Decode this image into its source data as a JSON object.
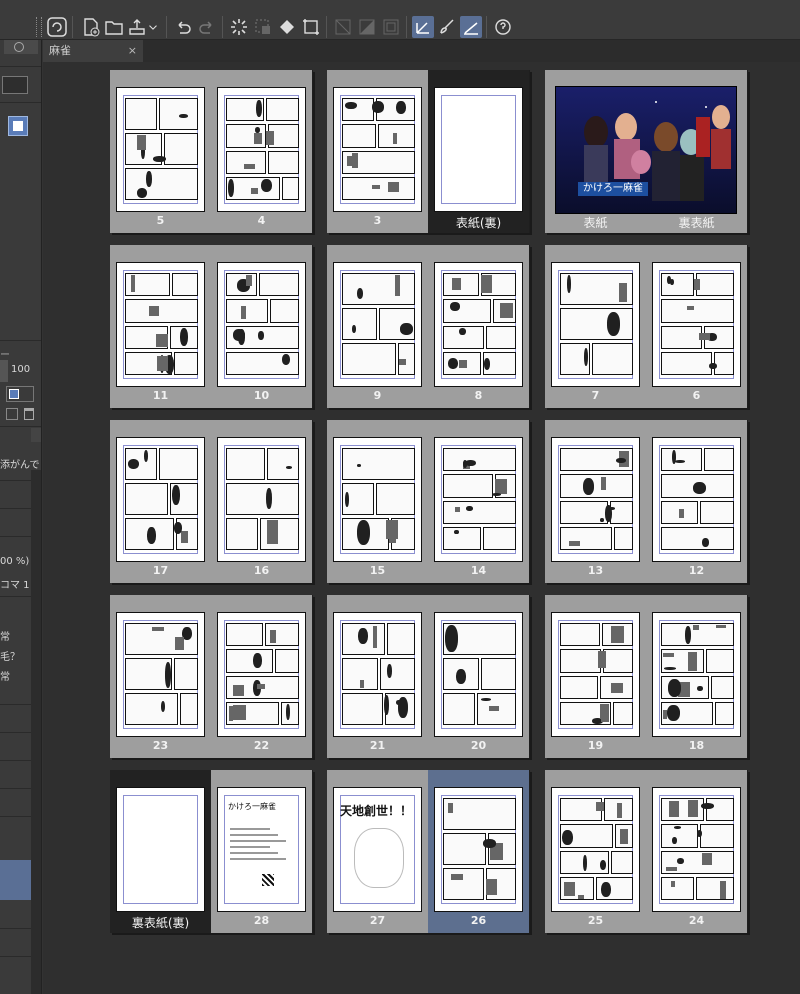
{
  "toolbar": {
    "items": [
      "clip-studio-logo",
      "new-file",
      "open-file",
      "export-dropdown",
      "undo",
      "redo",
      "transform-loading",
      "selection-layer",
      "fill",
      "transform",
      "fit-window",
      "rotate",
      "flip",
      "pen-tool",
      "brush-tool",
      "correction-line",
      "help-tips"
    ]
  },
  "left_panel": {
    "labels": {
      "opacity_value": "100",
      "text1": "添がんで",
      "text2": "00 %)",
      "text3": "コマ 1",
      "text4": "常",
      "text5": "毛？",
      "text6": "常"
    }
  },
  "document_tab": {
    "title": "麻雀",
    "close": "×"
  },
  "spreads": [
    {
      "left": {
        "label": "5"
      },
      "right": {
        "label": "4"
      }
    },
    {
      "left": {
        "label": "3"
      },
      "right": {
        "label": "表紙(裏)"
      }
    },
    {
      "cover": true,
      "left": {
        "label": "表紙"
      },
      "right": {
        "label": "裏表紙"
      },
      "cover_title": "かけろ一麻雀"
    },
    {
      "left": {
        "label": "11"
      },
      "right": {
        "label": "10"
      }
    },
    {
      "left": {
        "label": "9"
      },
      "right": {
        "label": "8"
      }
    },
    {
      "left": {
        "label": "7"
      },
      "right": {
        "label": "6"
      }
    },
    {
      "left": {
        "label": "17"
      },
      "right": {
        "label": "16"
      }
    },
    {
      "left": {
        "label": "15"
      },
      "right": {
        "label": "14"
      }
    },
    {
      "left": {
        "label": "13"
      },
      "right": {
        "label": "12"
      }
    },
    {
      "left": {
        "label": "23"
      },
      "right": {
        "label": "22"
      }
    },
    {
      "left": {
        "label": "21"
      },
      "right": {
        "label": "20"
      }
    },
    {
      "left": {
        "label": "19"
      },
      "right": {
        "label": "18"
      }
    },
    {
      "left": {
        "label": "裏表紙(裏)"
      },
      "right": {
        "label": "28"
      }
    },
    {
      "left": {
        "label": "27"
      },
      "right": {
        "label": "26"
      }
    },
    {
      "left": {
        "label": "25"
      },
      "right": {
        "label": "24"
      }
    }
  ],
  "page27_title": "天地創世！！",
  "page28_title": "かけろ一麻雀"
}
